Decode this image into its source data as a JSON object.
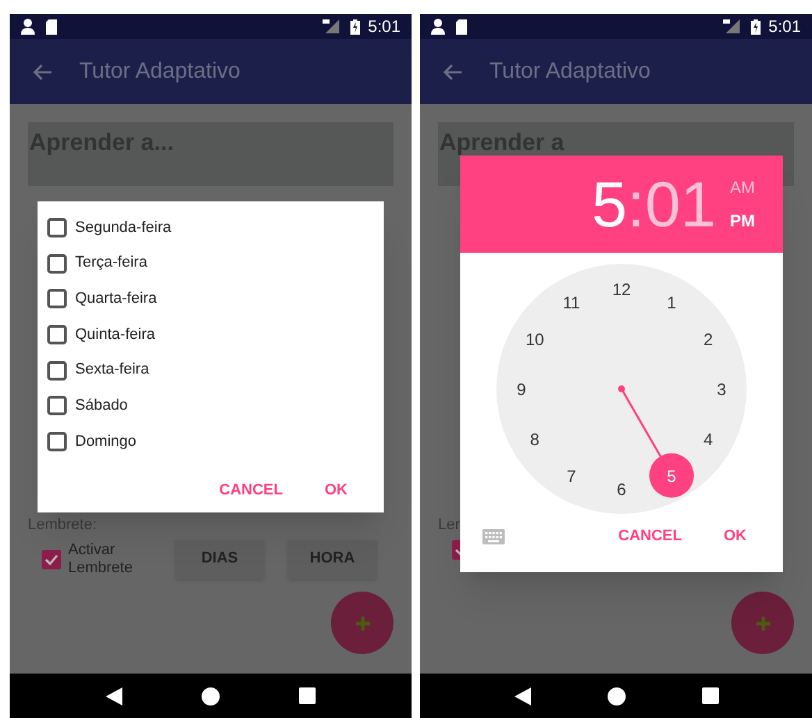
{
  "screens": [
    {
      "status_bar": {
        "time": "5:01"
      },
      "app_bar": {
        "title": "Tutor Adaptativo"
      },
      "input": {
        "value": "Aprender a..."
      },
      "reminder_label": "Lembrete:",
      "reminder_checkbox": {
        "label": "Activar Lembrete",
        "checked": true
      },
      "buttons": [
        "DIAS",
        "HORA"
      ],
      "dialog": {
        "kind": "days",
        "days": [
          {
            "label": "Segunda-feira",
            "checked": false
          },
          {
            "label": "Terça-feira",
            "checked": false
          },
          {
            "label": "Quarta-feira",
            "checked": false
          },
          {
            "label": "Quinta-feira",
            "checked": false
          },
          {
            "label": "Sexta-feira",
            "checked": false
          },
          {
            "label": "Sábado",
            "checked": false
          },
          {
            "label": "Domingo",
            "checked": false
          }
        ],
        "actions": [
          "CANCEL",
          "OK"
        ]
      }
    },
    {
      "status_bar": {
        "time": "5:01"
      },
      "app_bar": {
        "title": "Tutor Adaptativo"
      },
      "input": {
        "value": "Aprender a"
      },
      "reminder_label": "Ler",
      "reminder_checkbox": {
        "checked": true
      },
      "dialog": {
        "kind": "time",
        "hour": {
          "text": "5",
          "selected": true
        },
        "separator": ":",
        "minute": {
          "text": "01",
          "selected": false
        },
        "periods": [
          {
            "label": "AM",
            "selected": false
          },
          {
            "label": "PM",
            "selected": true
          }
        ],
        "dial": [
          {
            "label": "12",
            "selected": false
          },
          {
            "label": "1",
            "selected": false
          },
          {
            "label": "2",
            "selected": false
          },
          {
            "label": "3",
            "selected": false
          },
          {
            "label": "4",
            "selected": false
          },
          {
            "label": "5",
            "selected": true
          },
          {
            "label": "6",
            "selected": false
          },
          {
            "label": "7",
            "selected": false
          },
          {
            "label": "8",
            "selected": false
          },
          {
            "label": "9",
            "selected": false
          },
          {
            "label": "10",
            "selected": false
          },
          {
            "label": "11",
            "selected": false
          }
        ],
        "actions": [
          "CANCEL",
          "OK"
        ]
      }
    }
  ]
}
